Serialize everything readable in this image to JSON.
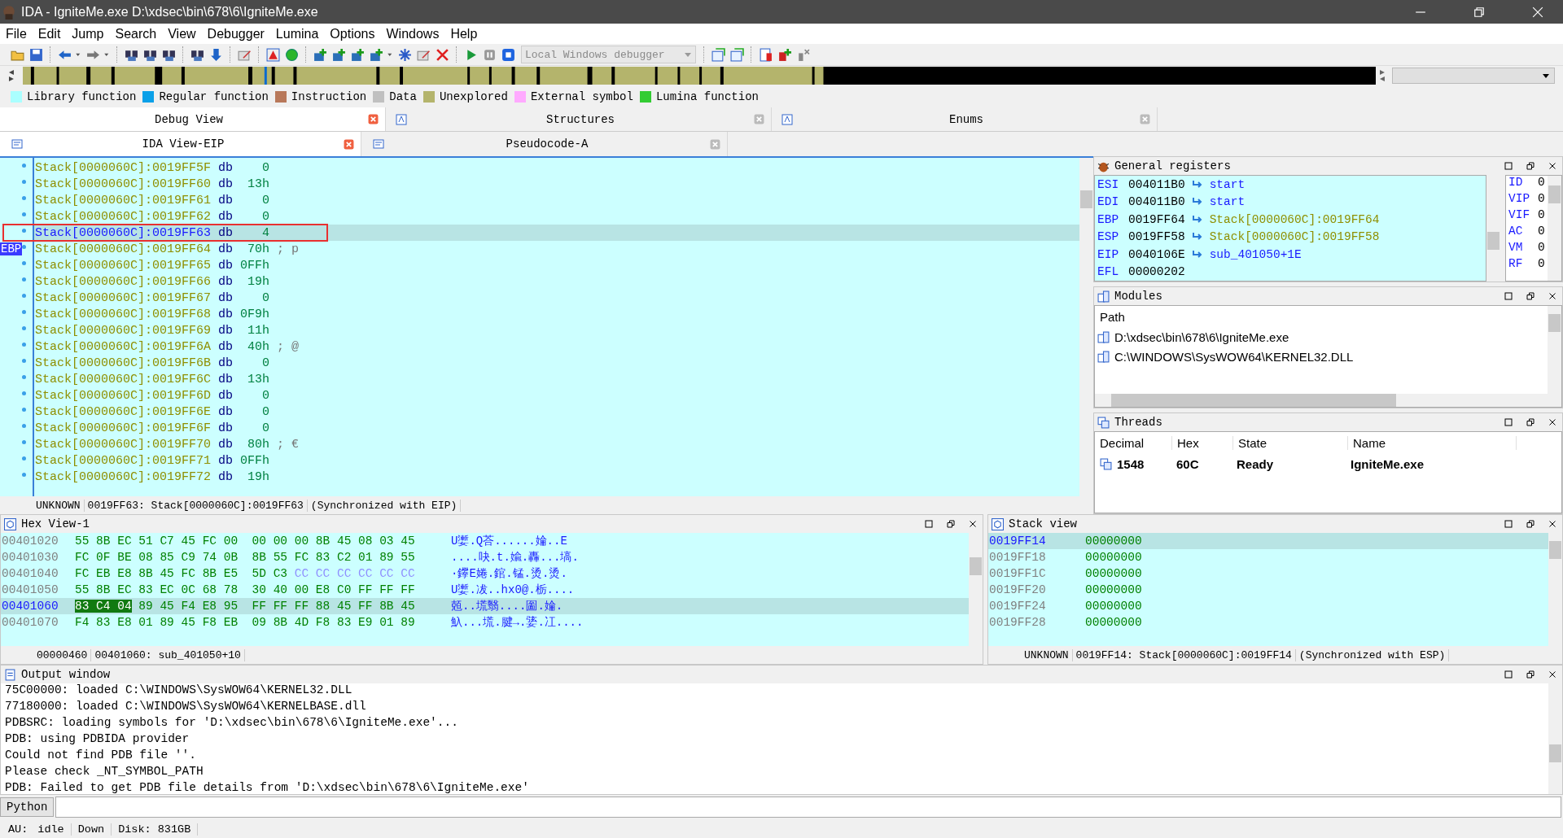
{
  "window": {
    "title": "IDA - IgniteMe.exe D:\\xdsec\\bin\\678\\6\\IgniteMe.exe"
  },
  "menu": [
    "File",
    "Edit",
    "Jump",
    "Search",
    "View",
    "Debugger",
    "Lumina",
    "Options",
    "Windows",
    "Help"
  ],
  "toolbar": {
    "debugger_select": {
      "value": "Local Windows debugger",
      "disabled": true
    }
  },
  "legend": [
    {
      "label": "Library function",
      "color": "#aaffff"
    },
    {
      "label": "Regular function",
      "color": "#0aa0e8"
    },
    {
      "label": "Instruction",
      "color": "#b8785a"
    },
    {
      "label": "Data",
      "color": "#c0c0c0"
    },
    {
      "label": "Unexplored",
      "color": "#b4b46c"
    },
    {
      "label": "External symbol",
      "color": "#ffaaff"
    },
    {
      "label": "Lumina function",
      "color": "#33cc33"
    }
  ],
  "top_tabs": [
    {
      "label": "Debug View",
      "selected": true
    },
    {
      "label": "Structures",
      "selected": false
    },
    {
      "label": "Enums",
      "selected": false
    }
  ],
  "view_tabs": [
    {
      "label": "IDA View-EIP",
      "selected": true
    },
    {
      "label": "Pseudocode-A",
      "selected": false
    }
  ],
  "ida_view": {
    "rows": [
      {
        "address": "Stack[0000060C]:0019FF5F",
        "op": "db",
        "value": "0",
        "selected": false
      },
      {
        "address": "Stack[0000060C]:0019FF60",
        "op": "db",
        "value": "13h",
        "selected": false
      },
      {
        "address": "Stack[0000060C]:0019FF61",
        "op": "db",
        "value": "0",
        "selected": false
      },
      {
        "address": "Stack[0000060C]:0019FF62",
        "op": "db",
        "value": "0",
        "selected": false
      },
      {
        "address": "Stack[0000060C]:0019FF63",
        "op": "db",
        "value": "4",
        "selected": true
      },
      {
        "address": "Stack[0000060C]:0019FF64",
        "op": "db",
        "value": "70h",
        "comment": "; p",
        "marker": "EBP",
        "selected": false
      },
      {
        "address": "Stack[0000060C]:0019FF65",
        "op": "db",
        "value": "0FFh",
        "selected": false
      },
      {
        "address": "Stack[0000060C]:0019FF66",
        "op": "db",
        "value": "19h",
        "selected": false
      },
      {
        "address": "Stack[0000060C]:0019FF67",
        "op": "db",
        "value": "0",
        "selected": false
      },
      {
        "address": "Stack[0000060C]:0019FF68",
        "op": "db",
        "value": "0F9h",
        "selected": false
      },
      {
        "address": "Stack[0000060C]:0019FF69",
        "op": "db",
        "value": "11h",
        "selected": false
      },
      {
        "address": "Stack[0000060C]:0019FF6A",
        "op": "db",
        "value": "40h",
        "comment": "; @",
        "selected": false
      },
      {
        "address": "Stack[0000060C]:0019FF6B",
        "op": "db",
        "value": "0",
        "selected": false
      },
      {
        "address": "Stack[0000060C]:0019FF6C",
        "op": "db",
        "value": "13h",
        "selected": false
      },
      {
        "address": "Stack[0000060C]:0019FF6D",
        "op": "db",
        "value": "0",
        "selected": false
      },
      {
        "address": "Stack[0000060C]:0019FF6E",
        "op": "db",
        "value": "0",
        "selected": false
      },
      {
        "address": "Stack[0000060C]:0019FF6F",
        "op": "db",
        "value": "0",
        "selected": false
      },
      {
        "address": "Stack[0000060C]:0019FF70",
        "op": "db",
        "value": "80h",
        "comment": "; €",
        "selected": false
      },
      {
        "address": "Stack[0000060C]:0019FF71",
        "op": "db",
        "value": "0FFh",
        "selected": false
      },
      {
        "address": "Stack[0000060C]:0019FF72",
        "op": "db",
        "value": "19h",
        "selected": false
      }
    ],
    "status": [
      "UNKNOWN",
      "0019FF63: Stack[0000060C]:0019FF63",
      "(Synchronized with EIP)"
    ]
  },
  "registers": {
    "title": "General registers",
    "rows": [
      {
        "name": "ESI",
        "value": "004011B0",
        "target": "start",
        "kind": "code"
      },
      {
        "name": "EDI",
        "value": "004011B0",
        "target": "start",
        "kind": "code"
      },
      {
        "name": "EBP",
        "value": "0019FF64",
        "target": "Stack[0000060C]:0019FF64",
        "kind": "stack"
      },
      {
        "name": "ESP",
        "value": "0019FF58",
        "target": "Stack[0000060C]:0019FF58",
        "kind": "stack"
      },
      {
        "name": "EIP",
        "value": "0040106E",
        "target": "sub_401050+1E",
        "kind": "code"
      },
      {
        "name": "EFL",
        "value": "00000202"
      }
    ],
    "flags": [
      {
        "name": "ID",
        "value": "0"
      },
      {
        "name": "VIP",
        "value": "0"
      },
      {
        "name": "VIF",
        "value": "0"
      },
      {
        "name": "AC",
        "value": "0"
      },
      {
        "name": "VM",
        "value": "0"
      },
      {
        "name": "RF",
        "value": "0"
      }
    ]
  },
  "modules": {
    "title": "Modules",
    "column": "Path",
    "items": [
      "D:\\xdsec\\bin\\678\\6\\IgniteMe.exe",
      "C:\\WINDOWS\\SysWOW64\\KERNEL32.DLL"
    ]
  },
  "threads": {
    "title": "Threads",
    "columns": [
      "Decimal",
      "Hex",
      "State",
      "Name"
    ],
    "rows": [
      [
        "1548",
        "60C",
        "Ready",
        "IgniteMe.exe"
      ]
    ]
  },
  "hex_view": {
    "title": "Hex View-1",
    "rows": [
      {
        "address": "00401020",
        "groups": [
          {
            "text": "55 8B EC 51 C7 45 FC 00  00 00 00 8B 45 08 03 45",
            "kind": "data"
          }
        ],
        "ascii": "U嬱.Q荅......婨..E",
        "selected": false
      },
      {
        "address": "00401030",
        "groups": [
          {
            "text": "FC 0F BE 08 85 C9 74 0B  8B 55 FC 83 C2 01 89 55",
            "kind": "data"
          }
        ],
        "ascii": "....吷.t.婾.轟...塙.",
        "selected": false
      },
      {
        "address": "00401040",
        "groups": [
          {
            "text": "FC EB E8 8B 45 FC 8B E5  5D C3",
            "kind": "data"
          },
          {
            "text": "CC CC CC CC CC CC",
            "kind": "filler"
          }
        ],
        "ascii": "·鑻E婘.錧.锰.烫.烫.",
        "selected": false
      },
      {
        "address": "00401050",
        "groups": [
          {
            "text": "55 8B EC 83 EC 0C 68 78  30 40 00 E8 C0 FF FF FF",
            "kind": "data"
          }
        ],
        "ascii": "U嬱.冹..hx0@.栃....",
        "selected": false
      },
      {
        "address": "00401060",
        "groups": [
          {
            "text": "83 C4 04",
            "kind": "cursor"
          },
          {
            "text": "89 45 F4 E8 95  FF FF FF 88 45 FF 8B 45",
            "kind": "data"
          }
        ],
        "ascii": "兡..塃翳....圗.婨.",
        "selected": true
      },
      {
        "address": "00401070",
        "groups": [
          {
            "text": "F4 83 E8 01 89 45 F8 EB  09 8B 4D F8 83 E9 01 89",
            "kind": "data"
          }
        ],
        "ascii": "魞...塃.腱→.婱.冮....",
        "selected": false
      }
    ],
    "status": [
      "00000460",
      "00401060: sub_401050+10"
    ]
  },
  "stack_view": {
    "title": "Stack view",
    "rows": [
      {
        "address": "0019FF14",
        "value": "00000000",
        "selected": true
      },
      {
        "address": "0019FF18",
        "value": "00000000",
        "selected": false
      },
      {
        "address": "0019FF1C",
        "value": "00000000",
        "selected": false
      },
      {
        "address": "0019FF20",
        "value": "00000000",
        "selected": false
      },
      {
        "address": "0019FF24",
        "value": "00000000",
        "selected": false
      },
      {
        "address": "0019FF28",
        "value": "00000000",
        "selected": false
      }
    ],
    "status": [
      "UNKNOWN",
      "0019FF14: Stack[0000060C]:0019FF14",
      "(Synchronized with ESP)"
    ]
  },
  "output": {
    "title": "Output window",
    "lines": [
      "75C00000: loaded C:\\WINDOWS\\SysWOW64\\KERNEL32.DLL",
      "77180000: loaded C:\\WINDOWS\\SysWOW64\\KERNELBASE.dll",
      "PDBSRC: loading symbols for 'D:\\xdsec\\bin\\678\\6\\IgniteMe.exe'...",
      "PDB: using PDBIDA provider",
      "Could not find PDB file ''.",
      "Please check _NT_SYMBOL_PATH",
      "PDB: Failed to get PDB file details from 'D:\\xdsec\\bin\\678\\6\\IgniteMe.exe'"
    ]
  },
  "command": {
    "language": "Python"
  },
  "status_bar": [
    "AU:",
    "idle",
    "Down",
    "Disk: 831GB"
  ]
}
